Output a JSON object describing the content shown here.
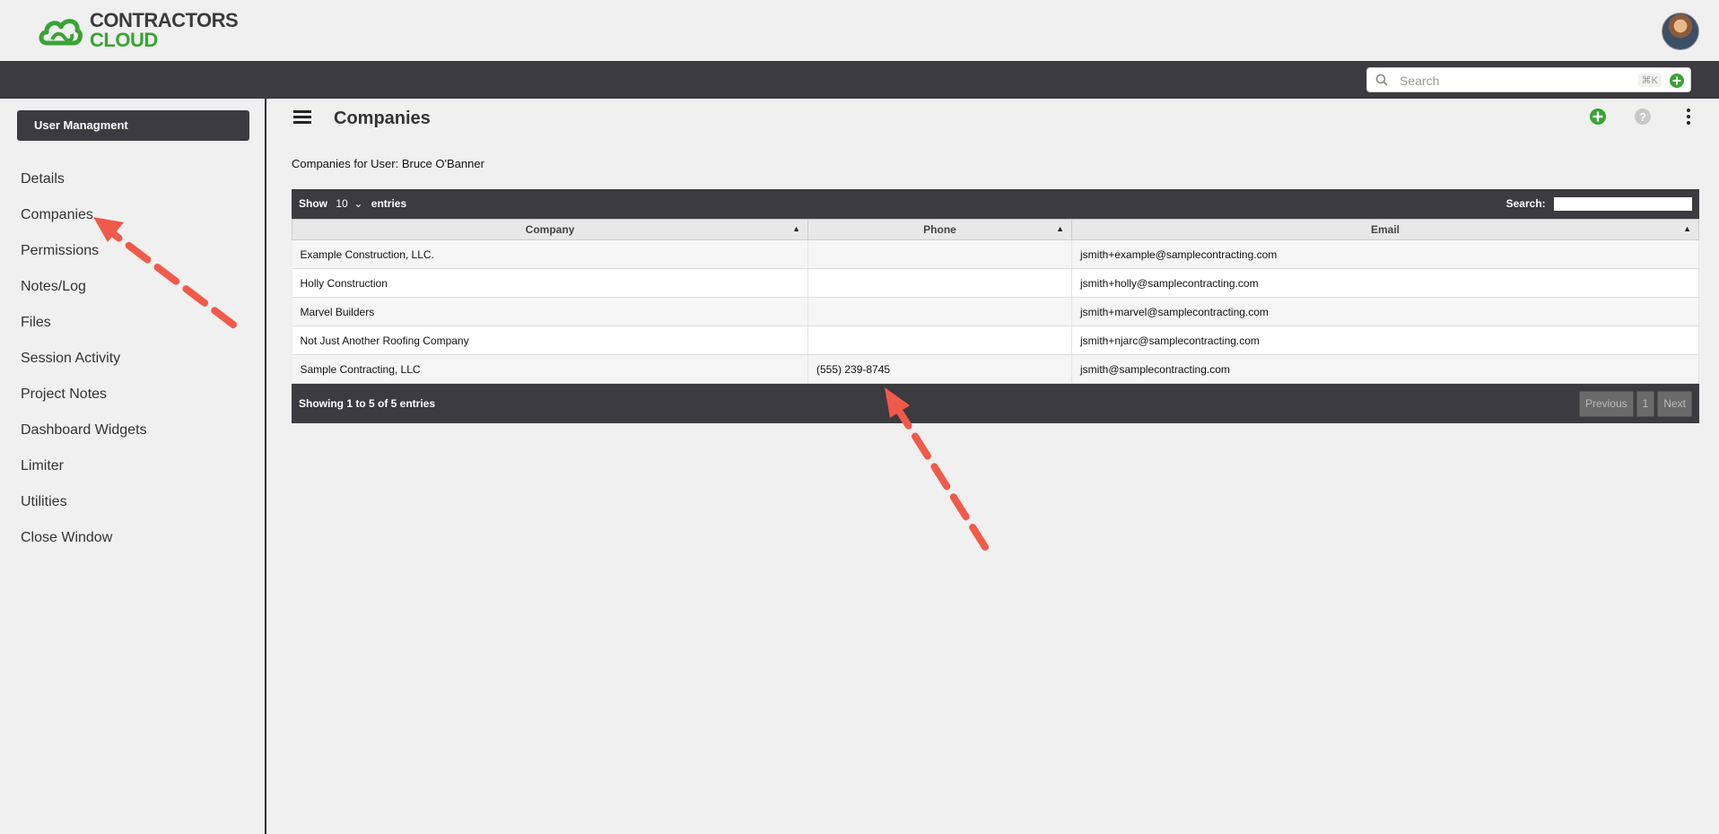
{
  "app": {
    "logo_line1": "CONTRACTORS",
    "logo_line2": "CLOUD",
    "brand_dark": "#3c3b3f",
    "brand_green": "#3aa335"
  },
  "global_search": {
    "placeholder": "Search",
    "shortcut": "⌘K"
  },
  "sidebar": {
    "header": "User Managment",
    "items": [
      {
        "label": "Details"
      },
      {
        "label": "Companies"
      },
      {
        "label": "Permissions"
      },
      {
        "label": "Notes/Log"
      },
      {
        "label": "Files"
      },
      {
        "label": "Session Activity"
      },
      {
        "label": "Project Notes"
      },
      {
        "label": "Dashboard Widgets"
      },
      {
        "label": "Limiter"
      },
      {
        "label": "Utilities"
      },
      {
        "label": "Close Window"
      }
    ]
  },
  "main": {
    "title": "Companies",
    "subtitle": "Companies for User: Bruce O'Banner",
    "icons": {
      "menu": "hamburger-icon",
      "add": "plus-circle-icon",
      "help": "question-circle-icon",
      "more": "vertical-ellipsis-icon"
    }
  },
  "table": {
    "length_show": "Show",
    "length_value": "10",
    "length_entries": "entries",
    "search_label": "Search:",
    "columns": [
      "Company",
      "Phone",
      "Email"
    ],
    "rows": [
      {
        "company": "Example Construction, LLC.",
        "phone": "",
        "email": "jsmith+example@samplecontracting.com"
      },
      {
        "company": "Holly Construction",
        "phone": "",
        "email": "jsmith+holly@samplecontracting.com"
      },
      {
        "company": "Marvel Builders",
        "phone": "",
        "email": "jsmith+marvel@samplecontracting.com"
      },
      {
        "company": "Not Just Another Roofing Company",
        "phone": "",
        "email": "jsmith+njarc@samplecontracting.com"
      },
      {
        "company": "Sample Contracting, LLC",
        "phone": "(555) 239-8745",
        "email": "jsmith@samplecontracting.com"
      }
    ],
    "info": "Showing 1 to 5 of 5 entries",
    "pager": {
      "previous": "Previous",
      "page": "1",
      "next": "Next"
    }
  },
  "annotation_color": "#f05a4a"
}
